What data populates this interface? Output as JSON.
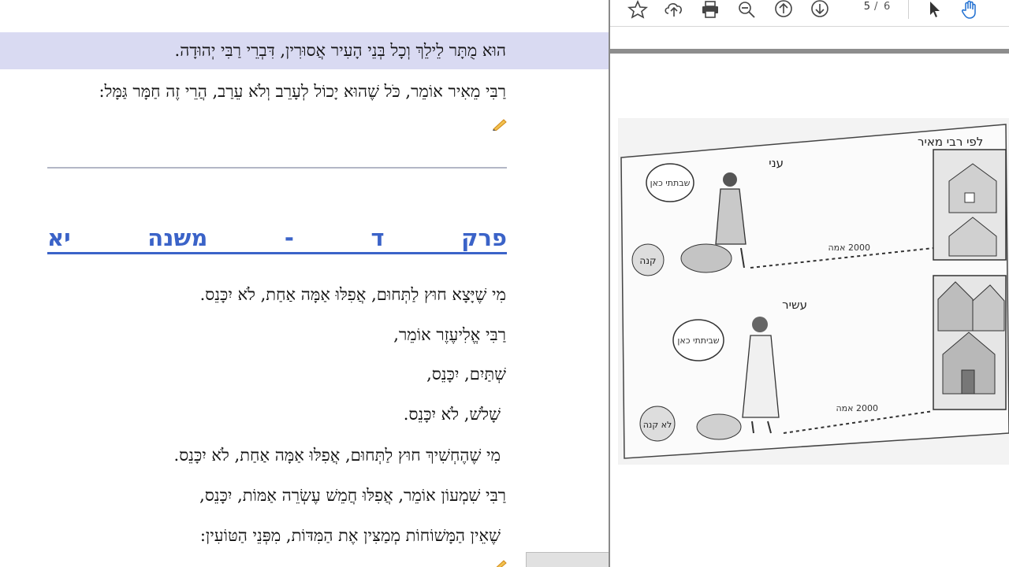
{
  "document": {
    "lines": {
      "highlighted": "הוּא מֻתָּר לֵילֵךְ וְכָל בְּנֵי הָעִיר אֲסוּרִין, דִּבְרֵי רַבִּי יְהוּדָה.",
      "meir": "רַבִּי מֵאִיר אוֹמֵר, כֹּל שֶׁהוּא יָכוֹל לְעָרֵב וְלֹא עֵרַב, הֲרֵי זֶה חַמָּר גַּמָּל:"
    },
    "chapter_heading": {
      "perek": "פרק",
      "letter": "ד",
      "dash": "-",
      "mishna": "משנה",
      "number": "יא"
    },
    "mishna_lines": [
      "מִי שֶׁיָּצָא חוּץ לַתְּחוּם, אֲפִלּוּ אַמָּה אַחַת, לֹא יִכָּנֵס.",
      "רַבִּי אֱלִיעֶזֶר אוֹמֵר,",
      "שְׁתַּיִם, יִכָּנֵס,",
      "שָׁלֹשׁ, לֹא יִכָּנֵס.",
      "מִי שֶׁהֶחְשִׁיךְ חוּץ לַתְּחוּם, אֲפִלּוּ אַמָּה אַחַת, לֹא יִכָּנֵס.",
      "רַבִּי שִׁמְעוֹן אוֹמֵר, אֲפִלּוּ חֲמֵשׁ עֶשְׂרֵה אַמּוֹת, יִכָּנֵס,",
      "שֶׁאֵין הַמָּשׁוֹחוֹת מְמַצִּין אֶת הַמִּדּוֹת, מִפְּנֵי הַטּוֹעִין:"
    ]
  },
  "pdf_viewer": {
    "toolbar": {
      "icons": [
        "star-icon",
        "upload-icon",
        "print-icon",
        "zoom-out-icon",
        "prev-page-icon",
        "next-page-icon",
        "select-cursor-icon",
        "hand-tool-icon"
      ],
      "current_page": "5",
      "separator": "/",
      "total_pages": "6"
    },
    "scan": {
      "title": "לפי רבי מאיר",
      "poor_label": "עני",
      "rich_label": "עשיר",
      "bubble_top": "שבתתי כאן",
      "bubble_bottom": "שביתתי כאן",
      "distance_top": "2000 אמה",
      "distance_bottom": "2000 אמה",
      "stone_top": "קנה",
      "stone_bottom": "לא קנה"
    }
  },
  "colors": {
    "highlight": "#d9daf2",
    "heading_blue": "#3b63c8",
    "divider": "#b3b7c6",
    "toolbar_blue": "#1f6fd1"
  }
}
